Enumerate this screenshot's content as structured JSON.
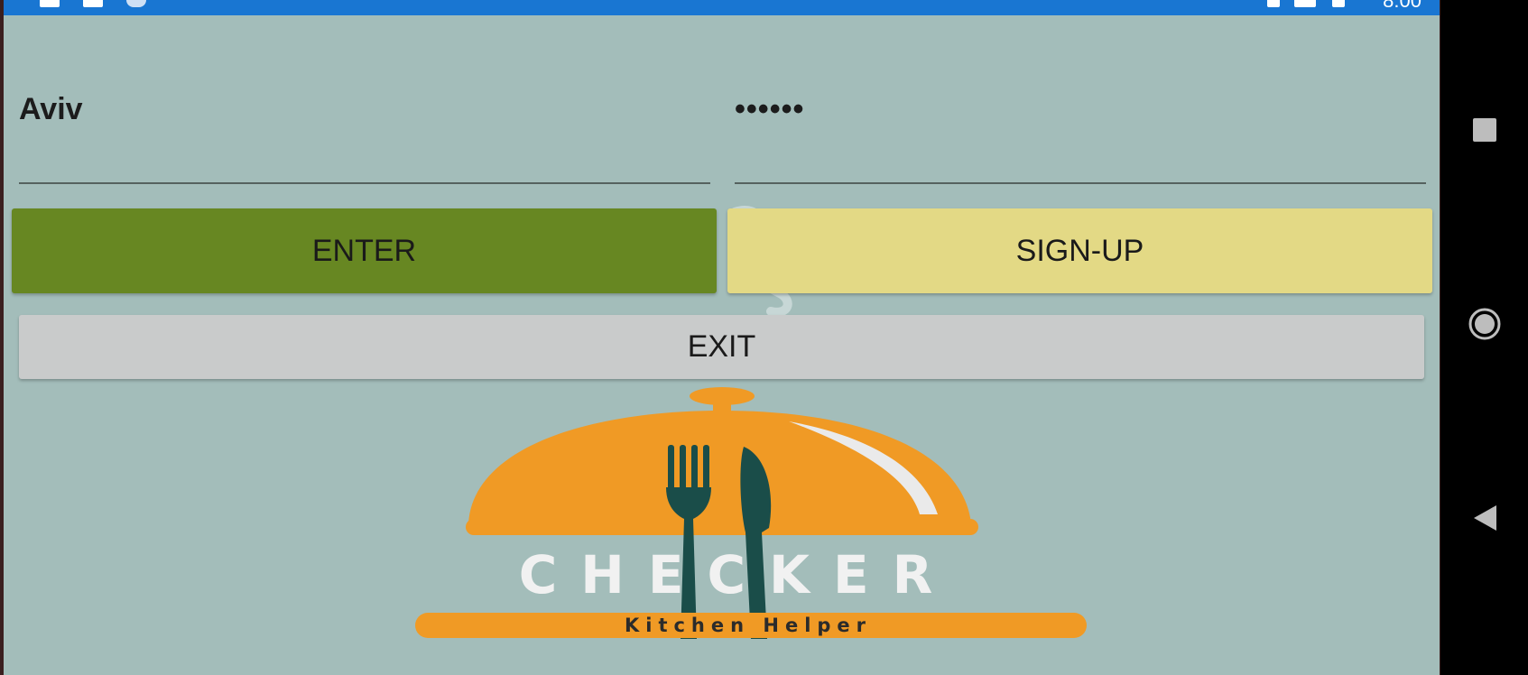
{
  "status_bar": {
    "time": "8:00"
  },
  "login": {
    "username_value": "Aviv",
    "password_value": "••••••"
  },
  "buttons": {
    "enter_label": "ENTER",
    "signup_label": "SIGN-UP",
    "exit_label": "EXIT"
  },
  "logo": {
    "title": "CHECKER",
    "subtitle": "Kitchen Helper"
  },
  "colors": {
    "background": "#a3bdba",
    "enter_button": "#678722",
    "signup_button": "#e3d985",
    "exit_button": "#c9cbcb",
    "status_bar": "#1976d2",
    "logo_orange": "#f09a25",
    "logo_dark_teal": "#1a4d49"
  },
  "nav_bar": {
    "icons": [
      "recents-square-icon",
      "home-circle-icon",
      "back-triangle-icon"
    ]
  }
}
